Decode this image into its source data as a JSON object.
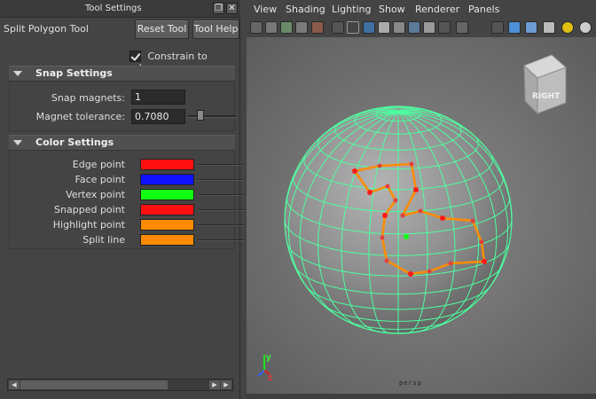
{
  "tool_window": {
    "title": "Tool Settings",
    "tool_name": "Split Polygon Tool",
    "reset_label": "Reset Tool",
    "help_label": "Tool Help",
    "constrain_label": "Constrain to edges",
    "constrain_checked": true
  },
  "snap_settings": {
    "header": "Snap Settings",
    "snap_magnets_label": "Snap magnets:",
    "snap_magnets_value": "1",
    "magnet_tolerance_label": "Magnet tolerance:",
    "magnet_tolerance_value": "0.7080",
    "magnet_tolerance_fraction": 0.25
  },
  "color_settings": {
    "header": "Color Settings",
    "items": [
      {
        "label": "Edge point",
        "color": "#ff1010"
      },
      {
        "label": "Face point",
        "color": "#1010ff"
      },
      {
        "label": "Vertex point",
        "color": "#10ff10"
      },
      {
        "label": "Snapped point",
        "color": "#ff1010"
      },
      {
        "label": "Highlight point",
        "color": "#ff8c00"
      },
      {
        "label": "Split line",
        "color": "#ff8c00"
      }
    ]
  },
  "viewport": {
    "menus": [
      "View",
      "Shading",
      "Lighting",
      "Show",
      "Renderer",
      "Panels"
    ],
    "viewcube_label": "RIGHT",
    "camera_label": "persp",
    "axis_labels": {
      "y": "y",
      "z": "z"
    },
    "wire_color": "#4dffa0",
    "split_line_color": "#ff8c00"
  }
}
